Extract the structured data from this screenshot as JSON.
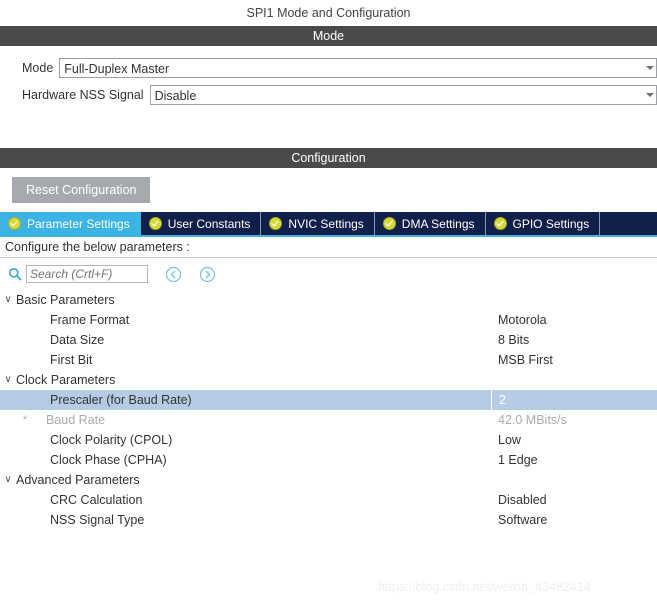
{
  "page_title": "SPI1 Mode and Configuration",
  "mode_section": {
    "header": "Mode",
    "rows": [
      {
        "label": "Mode",
        "value": "Full-Duplex Master"
      },
      {
        "label": "Hardware NSS Signal",
        "value": "Disable"
      }
    ]
  },
  "configuration_section": {
    "header": "Configuration",
    "reset_button": "Reset Configuration",
    "tabs": [
      {
        "label": "Parameter Settings",
        "active": true
      },
      {
        "label": "User Constants",
        "active": false
      },
      {
        "label": "NVIC Settings",
        "active": false
      },
      {
        "label": "DMA Settings",
        "active": false
      },
      {
        "label": "GPIO Settings",
        "active": false
      }
    ],
    "configure_hint": "Configure the below parameters :",
    "search": {
      "placeholder": "Search (Crtl+F)",
      "value": "",
      "prev_label": "‹",
      "next_label": "›"
    },
    "tree": [
      {
        "type": "group",
        "name": "Basic Parameters",
        "value": "",
        "twisty": "∨"
      },
      {
        "type": "child",
        "name": "Frame Format",
        "value": "Motorola"
      },
      {
        "type": "child",
        "name": "Data Size",
        "value": "8 Bits"
      },
      {
        "type": "child",
        "name": "First Bit",
        "value": "MSB First"
      },
      {
        "type": "group",
        "name": "Clock Parameters",
        "value": "",
        "twisty": "∨"
      },
      {
        "type": "child",
        "name": "Prescaler (for Baud Rate)",
        "value": "2",
        "selected": true
      },
      {
        "type": "child",
        "name": "Baud Rate",
        "value": "42.0 MBits/s",
        "disabled": true,
        "star": "*"
      },
      {
        "type": "child",
        "name": "Clock Polarity (CPOL)",
        "value": "Low"
      },
      {
        "type": "child",
        "name": "Clock Phase (CPHA)",
        "value": "1 Edge"
      },
      {
        "type": "group",
        "name": "Advanced Parameters",
        "value": "",
        "twisty": "∨"
      },
      {
        "type": "child",
        "name": "CRC Calculation",
        "value": "Disabled"
      },
      {
        "type": "child",
        "name": "NSS Signal Type",
        "value": "Software"
      }
    ]
  },
  "watermark": "https://blog.csdn.net/weixin_43482414",
  "colors": {
    "section_bar": "#4a4a4a",
    "tab_active": "#3bb4e5",
    "tab_inactive": "#10204a",
    "row_selected": "#b6cce4",
    "reset_button": "#a6aaae",
    "check_icon": "#d7d93b"
  }
}
